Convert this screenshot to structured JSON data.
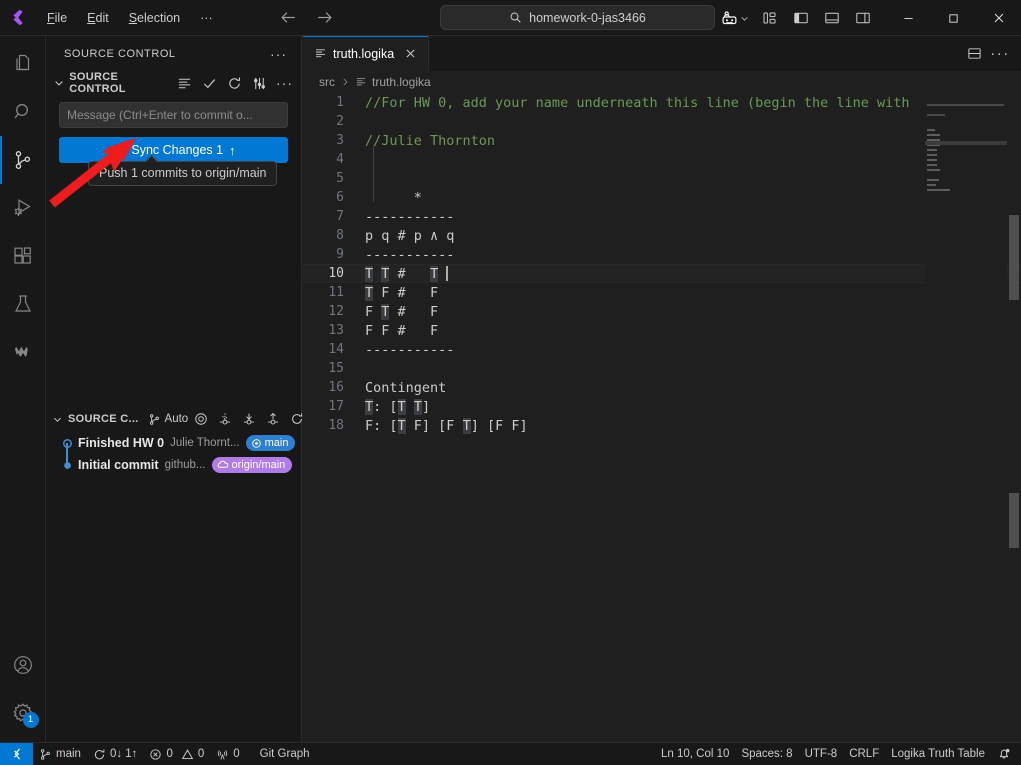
{
  "titlebar": {
    "menus": [
      "File",
      "Edit",
      "Selection"
    ],
    "overflow_label": "···",
    "back_icon": "arrow-left-icon",
    "forward_icon": "arrow-right-icon",
    "search_placeholder": "homework-0-jas3466",
    "search_icon": "search-icon",
    "remote_icon": "remote-explorer-icon",
    "chevron_icon": "chevron-down-icon",
    "layout_icons": [
      "customize-layout-icon",
      "toggle-primary-sidebar-icon",
      "toggle-panel-icon",
      "toggle-secondary-sidebar-icon"
    ],
    "minimize": "─",
    "maximize": "□",
    "close": "✕"
  },
  "activitybar": {
    "items": [
      {
        "name": "explorer",
        "icon": "files-icon",
        "active": false
      },
      {
        "name": "search",
        "icon": "search-icon",
        "active": false
      },
      {
        "name": "source-control",
        "icon": "source-control-icon",
        "active": true
      },
      {
        "name": "run-and-debug",
        "icon": "debug-icon",
        "active": false
      },
      {
        "name": "extensions",
        "icon": "extensions-icon",
        "active": false
      },
      {
        "name": "testing",
        "icon": "beaker-icon",
        "active": false
      },
      {
        "name": "logika",
        "icon": "logika-icon",
        "active": false
      }
    ],
    "bottom": [
      {
        "name": "accounts",
        "icon": "account-icon",
        "badge": ""
      },
      {
        "name": "manage",
        "icon": "gear-icon",
        "badge": "1"
      }
    ]
  },
  "sidebar": {
    "title": "SOURCE CONTROL",
    "more_actions": "···",
    "scm": {
      "section_title": "SOURCE CONTROL",
      "actions": [
        "view-as-list-icon",
        "commit-check-icon",
        "refresh-icon",
        "source-control-settings-icon",
        "more-actions-icon"
      ],
      "input_placeholder": "Message (Ctrl+Enter to commit o...",
      "sync_label": "Sync Changes 1",
      "sync_arrow": "↑",
      "sync_icon": "sync-icon",
      "tooltip": "Push 1 commits to origin/main"
    },
    "graph": {
      "section_title": "SOURCE C...",
      "auto_label": "Auto",
      "auto_icon": "branch-icon",
      "actions": [
        "target-icon",
        "pull-icon",
        "fetch-icon",
        "push-icon",
        "refresh-icon"
      ],
      "commits": [
        {
          "message": "Finished HW 0",
          "author": "Julie Thornt...",
          "chip": "main",
          "chip_icon": "circle-target-icon",
          "chip_type": "main",
          "node": "open"
        },
        {
          "message": "Initial commit",
          "author": "github...",
          "chip": "origin/main",
          "chip_icon": "cloud-icon",
          "chip_type": "origin",
          "node": "filled"
        }
      ]
    }
  },
  "editor": {
    "tabs": [
      {
        "label": "truth.logika",
        "icon": "logika-file-icon",
        "active": true,
        "close_icon": "close-icon"
      }
    ],
    "tab_actions": [
      "split-editor-down-icon",
      "more-actions-icon"
    ],
    "breadcrumbs": [
      {
        "label": "src",
        "icon": ""
      },
      {
        "label": "truth.logika",
        "icon": "logika-file-icon"
      }
    ],
    "lines": [
      {
        "n": 1,
        "segments": [
          {
            "t": "//For HW 0, add your name underneath this line (begin the line with",
            "c": "comment"
          }
        ]
      },
      {
        "n": 2,
        "segments": []
      },
      {
        "n": 3,
        "segments": [
          {
            "t": "//Julie Thornton",
            "c": "comment"
          }
        ]
      },
      {
        "n": 4,
        "segments": []
      },
      {
        "n": 5,
        "segments": []
      },
      {
        "n": 6,
        "segments": [
          {
            "t": "      *",
            "c": "plain"
          }
        ]
      },
      {
        "n": 7,
        "segments": [
          {
            "t": "-----------",
            "c": "plain"
          }
        ]
      },
      {
        "n": 8,
        "segments": [
          {
            "t": "p q # p ∧ q",
            "c": "plain"
          }
        ]
      },
      {
        "n": 9,
        "segments": [
          {
            "t": "-----------",
            "c": "plain"
          }
        ]
      },
      {
        "n": 10,
        "segments": [
          {
            "t": "T",
            "c": "hl"
          },
          {
            "t": " ",
            "c": "plain"
          },
          {
            "t": "T",
            "c": "hl"
          },
          {
            "t": " #   ",
            "c": "plain"
          },
          {
            "t": "T",
            "c": "hl"
          }
        ],
        "current": true
      },
      {
        "n": 11,
        "segments": [
          {
            "t": "T",
            "c": "hl"
          },
          {
            "t": " F #   F",
            "c": "plain"
          }
        ]
      },
      {
        "n": 12,
        "segments": [
          {
            "t": "F ",
            "c": "plain"
          },
          {
            "t": "T",
            "c": "hl"
          },
          {
            "t": " #   F",
            "c": "plain"
          }
        ]
      },
      {
        "n": 13,
        "segments": [
          {
            "t": "F F #   F",
            "c": "plain"
          }
        ]
      },
      {
        "n": 14,
        "segments": [
          {
            "t": "-----------",
            "c": "plain"
          }
        ]
      },
      {
        "n": 15,
        "segments": []
      },
      {
        "n": 16,
        "segments": [
          {
            "t": "Contingent",
            "c": "plain"
          }
        ]
      },
      {
        "n": 17,
        "segments": [
          {
            "t": "T",
            "c": "hl"
          },
          {
            "t": ": [",
            "c": "plain"
          },
          {
            "t": "T",
            "c": "hl"
          },
          {
            "t": " ",
            "c": "plain"
          },
          {
            "t": "T",
            "c": "hl"
          },
          {
            "t": "]",
            "c": "plain"
          }
        ]
      },
      {
        "n": 18,
        "segments": [
          {
            "t": "F: [",
            "c": "plain"
          },
          {
            "t": "T",
            "c": "hl"
          },
          {
            "t": " F] [F ",
            "c": "plain"
          },
          {
            "t": "T",
            "c": "hl"
          },
          {
            "t": "] [F F]",
            "c": "plain"
          }
        ]
      }
    ]
  },
  "statusbar": {
    "remote_icon": "remote-window-icon",
    "left": [
      {
        "name": "branch",
        "icon": "branch-icon",
        "text": "main"
      },
      {
        "name": "sync",
        "icon": "sync-icon",
        "text": "0↓ 1↑"
      },
      {
        "name": "errors",
        "icon": "error-icon",
        "text": "0",
        "icon2": "warning-icon",
        "text2": "0"
      },
      {
        "name": "ports",
        "icon": "radio-tower-icon",
        "text": "0"
      },
      {
        "name": "git-graph",
        "icon": "",
        "text": "Git Graph"
      }
    ],
    "right": [
      {
        "name": "cursor-position",
        "text": "Ln 10, Col 10"
      },
      {
        "name": "indentation",
        "text": "Spaces: 8"
      },
      {
        "name": "encoding",
        "text": "UTF-8"
      },
      {
        "name": "eol",
        "text": "CRLF"
      },
      {
        "name": "language-mode",
        "text": "Logika Truth Table"
      },
      {
        "name": "notifications",
        "icon": "bell-dot-icon",
        "text": ""
      }
    ]
  },
  "annotation": {
    "arrow_color": "#ee1c1c",
    "description": "red-arrow-pointing-at-sync-changes-button"
  }
}
